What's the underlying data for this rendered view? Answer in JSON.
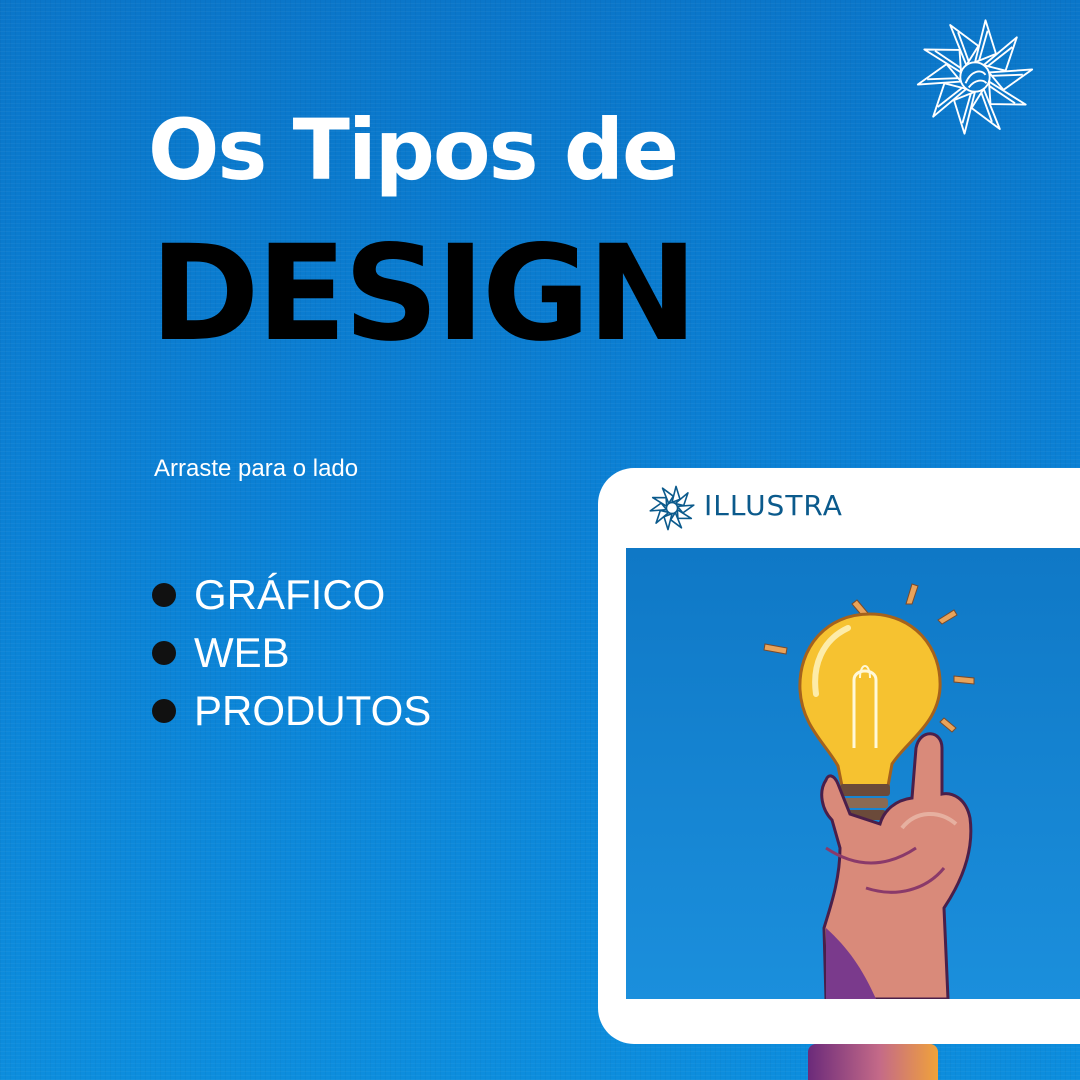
{
  "title": {
    "line1": "Os Tipos de",
    "line2": "DESIGN"
  },
  "subtitle": "Arraste para o lado",
  "design_types": [
    "GRÁFICO",
    "WEB",
    "PRODUTOS"
  ],
  "brand": {
    "name": "ILLUSTRA",
    "icon": "starburst-logo-icon"
  },
  "illustration": {
    "icon": "lightbulb-hand-icon"
  },
  "colors": {
    "background": "#0b80d4",
    "title_white": "#ffffff",
    "title_black": "#000000",
    "brand_text": "#0b5a8c",
    "bulb_yellow": "#f6c230",
    "hand_purple": "#7a3a8c"
  }
}
